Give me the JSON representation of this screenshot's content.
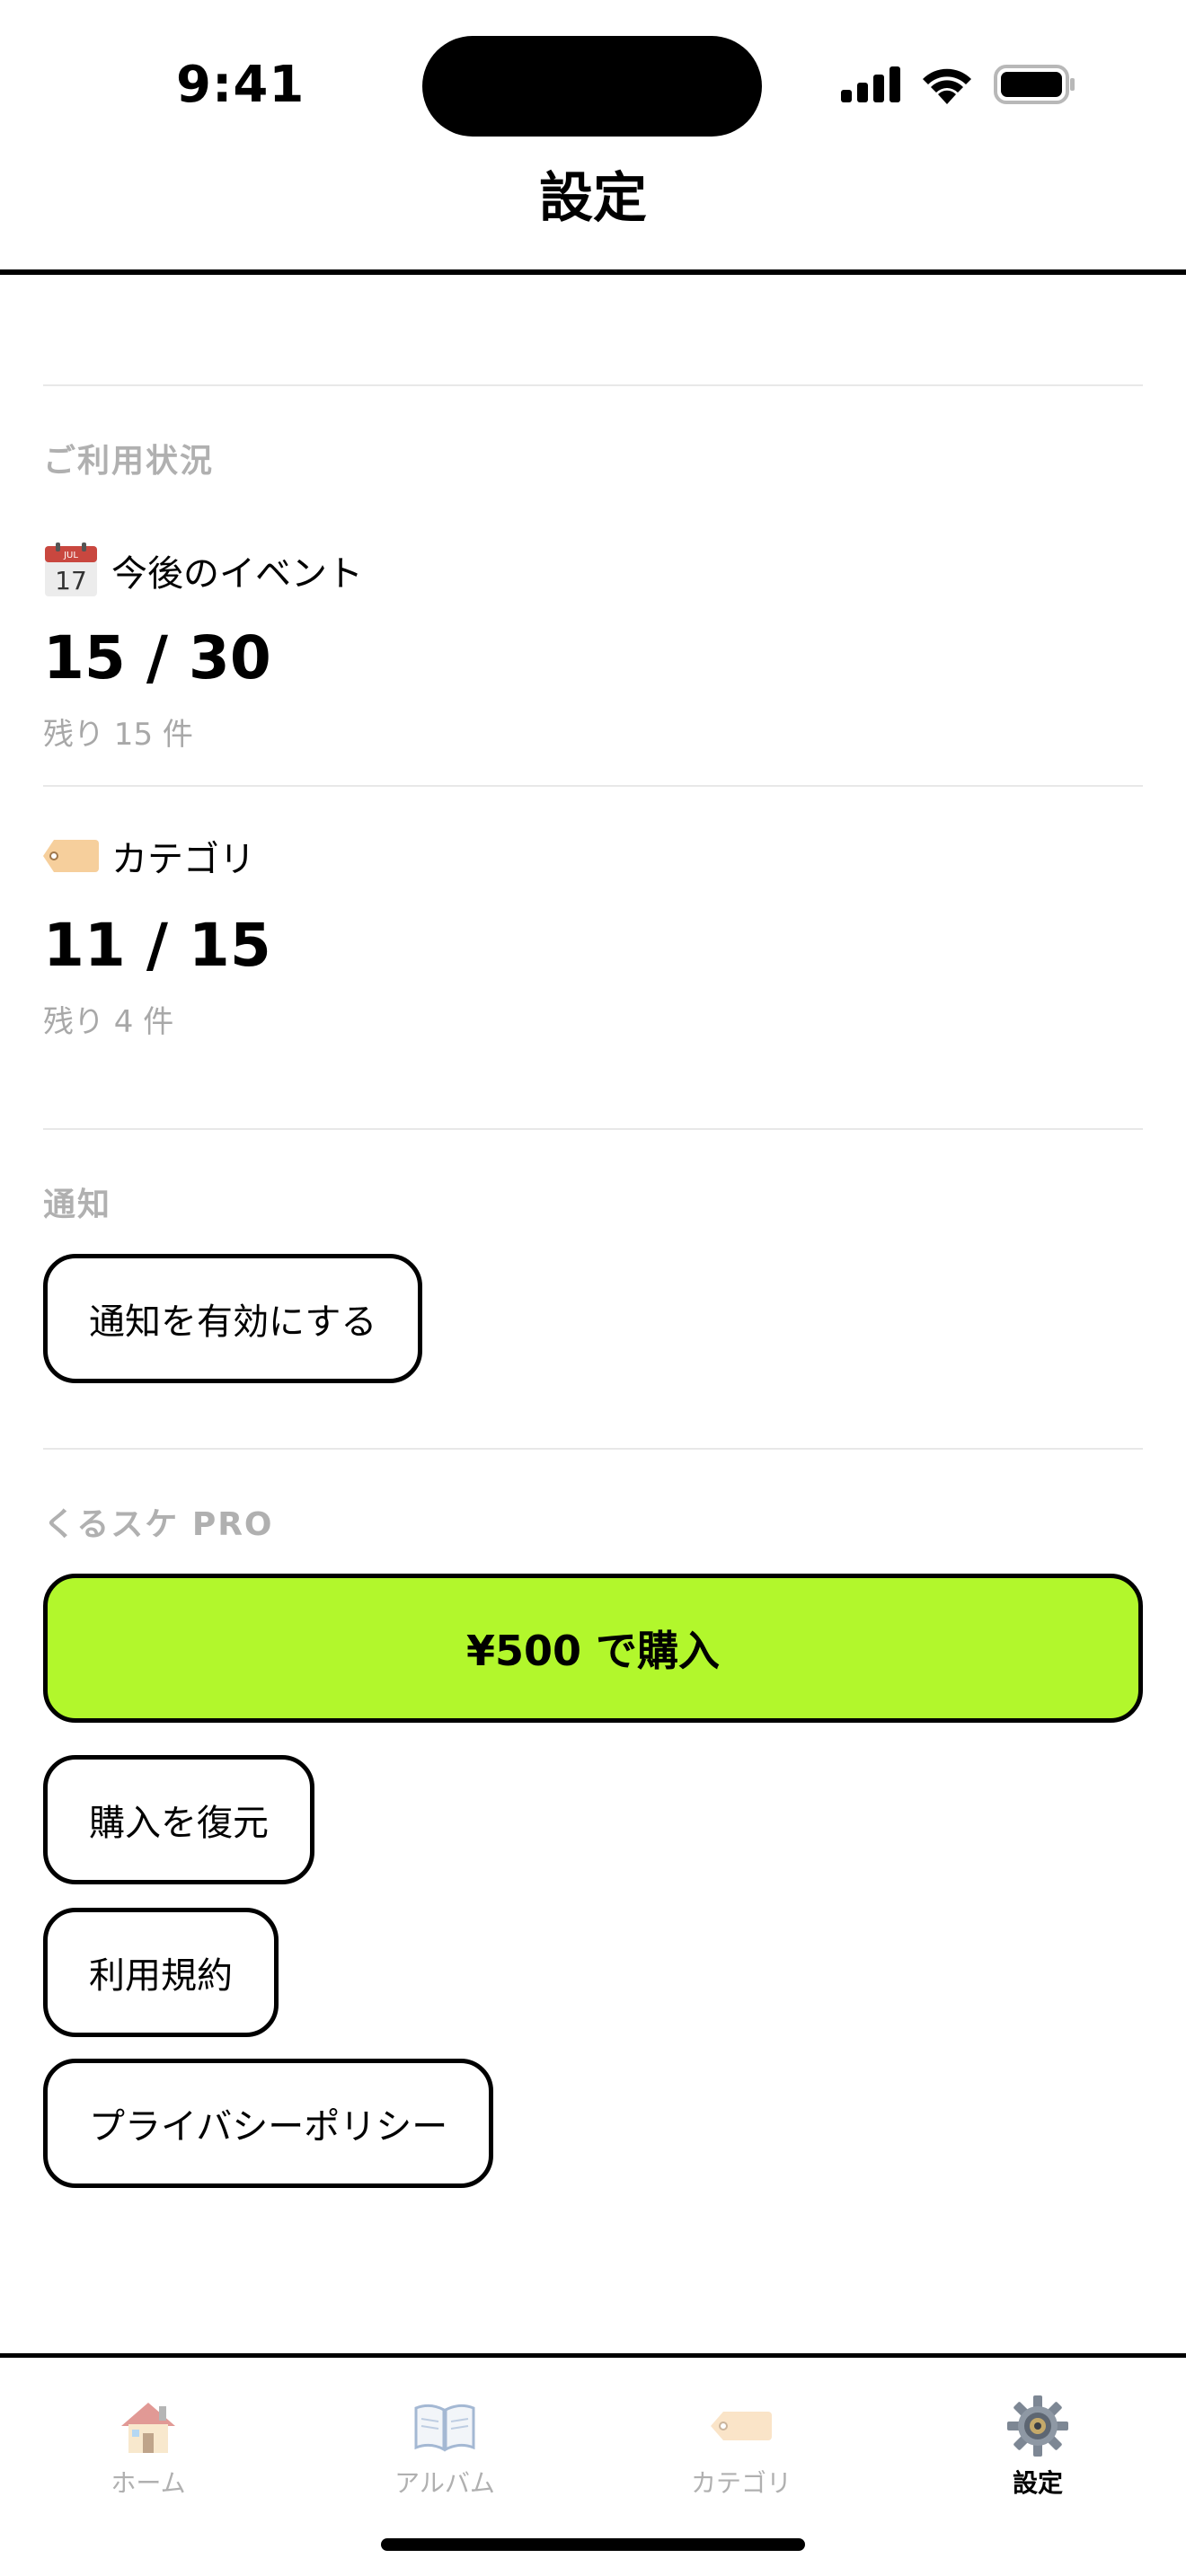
{
  "status_bar": {
    "time": "9:41"
  },
  "header": {
    "title": "設定"
  },
  "usage": {
    "section_label": "ご利用状況",
    "events": {
      "label": "今後のイベント",
      "count": "15 / 30",
      "remaining": "残り 15 件",
      "icon": "calendar-icon",
      "value": 15,
      "limit": 30
    },
    "categories": {
      "label": "カテゴリ",
      "count": "11 / 15",
      "remaining": "残り 4 件",
      "icon": "tag-icon",
      "value": 11,
      "limit": 15
    }
  },
  "notifications": {
    "section_label": "通知",
    "enable_label": "通知を有効にする"
  },
  "pro": {
    "section_label": "くるスケ PRO",
    "buy_label": "¥500 で購入",
    "restore_label": "購入を復元",
    "terms_label": "利用規約",
    "privacy_label": "プライバシーポリシー"
  },
  "tabs": [
    {
      "label": "ホーム",
      "icon": "house-icon",
      "active": false
    },
    {
      "label": "アルバム",
      "icon": "open-book-icon",
      "active": false
    },
    {
      "label": "カテゴリ",
      "icon": "tag-icon",
      "active": false
    },
    {
      "label": "設定",
      "icon": "gear-icon",
      "active": true
    }
  ],
  "colors": {
    "accent": "#b2f72c",
    "section_label": "#b0b0b0",
    "text": "#000000"
  }
}
